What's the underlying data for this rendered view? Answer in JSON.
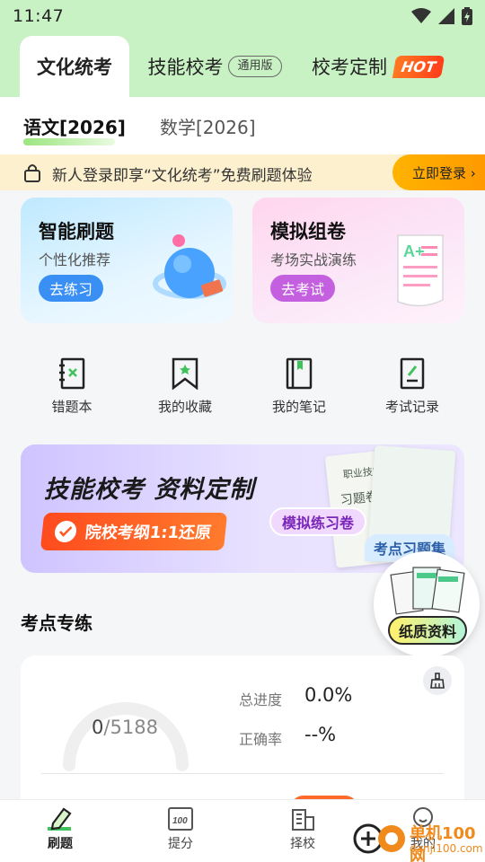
{
  "status_bar": {
    "time": "11:47"
  },
  "top_tabs": [
    {
      "label": "文化统考",
      "active": true
    },
    {
      "label": "技能校考",
      "badge": "通用版",
      "active": false
    },
    {
      "label": "校考定制",
      "badge": "HOT",
      "active": false
    }
  ],
  "subject_tabs": [
    {
      "label": "语文[2026]",
      "active": true
    },
    {
      "label": "数学[2026]",
      "active": false
    }
  ],
  "notice": {
    "message": "新人登录即享“文化统考”免费刷题体验",
    "button": "立即登录 ›"
  },
  "feature_cards": [
    {
      "title": "智能刷题",
      "subtitle": "个性化推荐",
      "button": "去练习"
    },
    {
      "title": "模拟组卷",
      "subtitle": "考场实战演练",
      "button": "去考试"
    }
  ],
  "tools": [
    {
      "label": "错题本",
      "icon": "wrong-book-icon"
    },
    {
      "label": "我的收藏",
      "icon": "bookmark-icon"
    },
    {
      "label": "我的笔记",
      "icon": "notebook-icon"
    },
    {
      "label": "考试记录",
      "icon": "exam-record-icon"
    }
  ],
  "promo": {
    "headline": "技能校考  资料定制",
    "ribbon": "院校考纲1:1还原",
    "pill": "模拟练习卷",
    "tag": "考点习题集",
    "book_front": "职业技能测试",
    "book_back": "习题卷"
  },
  "paper_badge": {
    "label": "纸质资料"
  },
  "section": {
    "title": "考点专练"
  },
  "stats": {
    "done": "0",
    "total": "/5188",
    "progress_label": "总进度",
    "progress_value": "0.0%",
    "accuracy_label": "正确率",
    "accuracy_value": "--%"
  },
  "bottom_nav": [
    {
      "label": "刷题",
      "active": true,
      "icon": "practice-icon"
    },
    {
      "label": "提分",
      "active": false,
      "icon": "score-icon"
    },
    {
      "label": "择校",
      "active": false,
      "icon": "school-icon"
    },
    {
      "label": "我的",
      "active": false,
      "icon": "profile-icon"
    }
  ],
  "watermark": {
    "name": "单机100网",
    "url": "danji100.com"
  },
  "colors": {
    "top_bg": "#c9f2c4",
    "accent_blue": "#3a8ff5",
    "accent_purple": "#c460e0",
    "notice_bg": "#fdf0cf",
    "login_button": "#ffa800",
    "ribbon_orange": "#ff5a22"
  }
}
